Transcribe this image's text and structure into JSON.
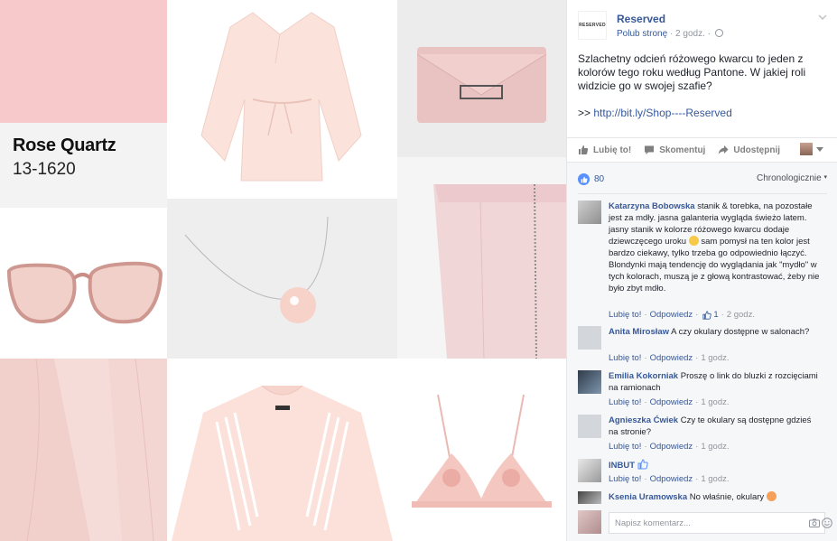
{
  "collage": {
    "swatch_name": "Rose Quartz",
    "swatch_code": "13-1620",
    "colors": {
      "swatch": "#f7c9cb",
      "blush": "#f5d2cf",
      "rose": "#e9b3b0"
    }
  },
  "post": {
    "page_name": "Reserved",
    "page_logo_text": "RESERVED",
    "like_page": "Polub stronę",
    "time": "2 godz.",
    "text": "Szlachetny odcień różowego kwarcu to jeden z kolorów tego roku według Pantone. W jakiej roli widzicie go w swojej szafie?",
    "link_prefix": ">>",
    "link": "http://bit.ly/Shop----Reserved"
  },
  "actions": {
    "like": "Lubię to!",
    "comment": "Skomentuj",
    "share": "Udostępnij"
  },
  "comments_section": {
    "likes_count": "80",
    "sort": "Chronologicznie",
    "comments": [
      {
        "name": "Katarzyna Bobowska",
        "text": "stanik & torebka, na pozostałe jest za mdły. jasna galanteria wygląda świeżo latem. jasny stanik w kolorze różowego kwarcu dodaje dziewczęcego uroku",
        "text2": "sam pomysł na ten kolor jest bardzo ciekawy, tylko trzeba go odpowiednio łączyć. Blondynki mają tendencję do wyglądania jak \"mydło\" w tych kolorach, muszą je z głową kontrastować, żeby nie było zbyt mdło.",
        "like": "Lubię to!",
        "reply": "Odpowiedz",
        "likes": "1",
        "time": "2 godz."
      },
      {
        "name": "Anita Mirosław",
        "text": "A czy okulary dostępne w salonach?",
        "like": "Lubię to!",
        "reply": "Odpowiedz",
        "time": "1 godz."
      },
      {
        "name": "Emilia Kokorniak",
        "text": "Proszę o link do bluzki z rozcięciami na ramionach",
        "like": "Lubię to!",
        "reply": "Odpowiedz",
        "time": "1 godz."
      },
      {
        "name": "Agnieszka Ćwiek",
        "text": "Czy te okulary są dostępne gdzieś na stronie?",
        "like": "Lubię to!",
        "reply": "Odpowiedz",
        "time": "1 godz."
      },
      {
        "name": "INBUT",
        "text": "",
        "like": "Lubię to!",
        "reply": "Odpowiedz",
        "time": "1 godz."
      },
      {
        "name": "Ksenia Uramowska",
        "text": "No właśnie, okulary"
      }
    ],
    "write_placeholder": "Napisz komentarz..."
  }
}
